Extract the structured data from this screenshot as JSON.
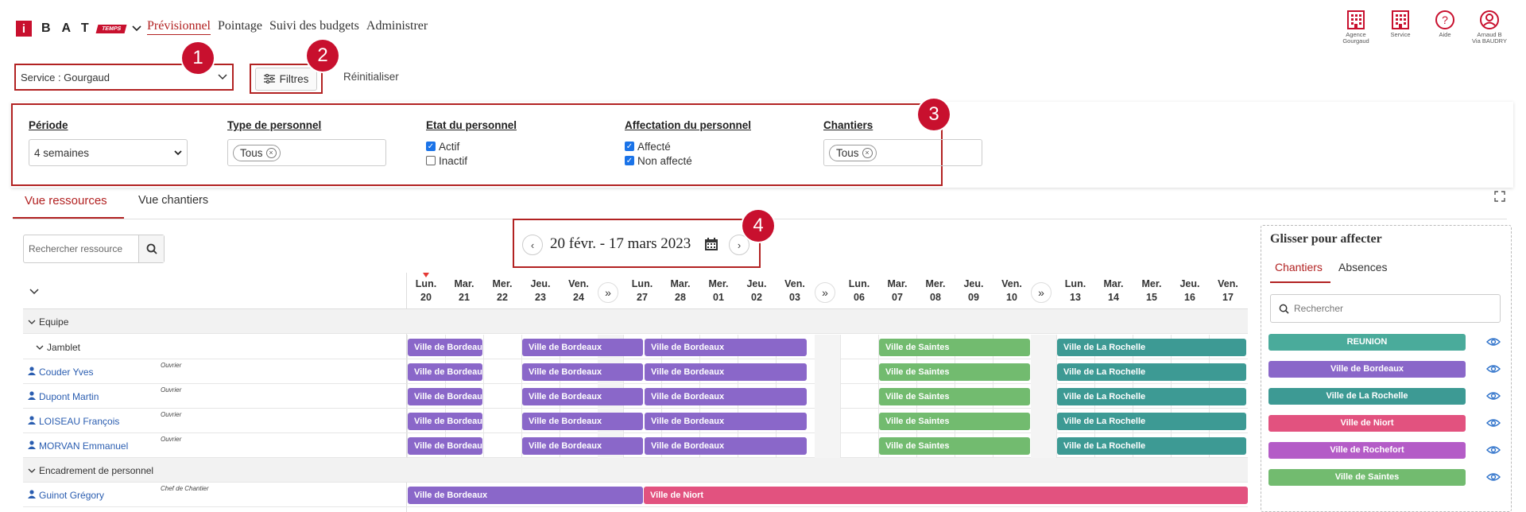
{
  "header": {
    "logo_i": "i",
    "logo_letters": "BAT",
    "logo_temps": "TEMPS",
    "nav": [
      "Prévisionnel",
      "Pointage",
      "Suivi des budgets",
      "Administrer"
    ],
    "icons": [
      {
        "label1": "Agence",
        "label2": "Gourgaud",
        "icon": "building-icon"
      },
      {
        "label1": "Service",
        "label2": "",
        "icon": "building-icon"
      },
      {
        "label1": "Aide",
        "label2": "",
        "icon": "help-icon"
      },
      {
        "label1": "Arnaud B",
        "label2": "Via BAUDRY",
        "icon": "user-icon"
      }
    ]
  },
  "filters": {
    "service": "Service : Gourgaud",
    "filtres_label": "Filtres",
    "reset_label": "Réinitialiser",
    "periode_label": "Période",
    "periode_value": "4 semaines",
    "type_label": "Type de personnel",
    "type_chip": "Tous",
    "etat_label": "Etat du personnel",
    "etat_actif": "Actif",
    "etat_inactif": "Inactif",
    "affect_label": "Affectation du personnel",
    "affect_affecte": "Affecté",
    "affect_non": "Non affecté",
    "chantiers_label": "Chantiers",
    "chantiers_chip": "Tous"
  },
  "badges": [
    "1",
    "2",
    "3",
    "4"
  ],
  "tabs": {
    "ressources": "Vue ressources",
    "chantiers": "Vue chantiers"
  },
  "search_res_placeholder": "Rechercher ressource",
  "date_range": "20 févr. - 17 mars 2023",
  "days": [
    {
      "d": "Lun.",
      "n": "20"
    },
    {
      "d": "Mar.",
      "n": "21"
    },
    {
      "d": "Mer.",
      "n": "22"
    },
    {
      "d": "Jeu.",
      "n": "23"
    },
    {
      "d": "Ven.",
      "n": "24"
    },
    {
      "d": "Lun.",
      "n": "27"
    },
    {
      "d": "Mar.",
      "n": "28"
    },
    {
      "d": "Mer.",
      "n": "01"
    },
    {
      "d": "Jeu.",
      "n": "02"
    },
    {
      "d": "Ven.",
      "n": "03"
    },
    {
      "d": "Lun.",
      "n": "06"
    },
    {
      "d": "Mar.",
      "n": "07"
    },
    {
      "d": "Mer.",
      "n": "08"
    },
    {
      "d": "Jeu.",
      "n": "09"
    },
    {
      "d": "Ven.",
      "n": "10"
    },
    {
      "d": "Lun.",
      "n": "13"
    },
    {
      "d": "Mar.",
      "n": "14"
    },
    {
      "d": "Mer.",
      "n": "15"
    },
    {
      "d": "Jeu.",
      "n": "16"
    },
    {
      "d": "Ven.",
      "n": "17"
    }
  ],
  "rows": [
    {
      "type": "group",
      "name": "Equipe"
    },
    {
      "type": "subgroup",
      "name": "Jamblet"
    },
    {
      "type": "person",
      "name": "Couder Yves",
      "role": "Ouvrier"
    },
    {
      "type": "person",
      "name": "Dupont Martin",
      "role": "Ouvrier"
    },
    {
      "type": "person",
      "name": "LOISEAU François",
      "role": "Ouvrier"
    },
    {
      "type": "person",
      "name": "MORVAN Emmanuel",
      "role": "Ouvrier"
    },
    {
      "type": "group",
      "name": "Encadrement de personnel"
    },
    {
      "type": "person",
      "name": "Guinot Grégory",
      "role": "Chef de Chantier"
    }
  ],
  "assignments": {
    "bordeaux": "Ville de Bordeaux",
    "saintes": "Ville de Saintes",
    "rochelle": "Ville de La Rochelle",
    "niort": "Ville de Niort"
  },
  "right_panel": {
    "title": "Glisser pour affecter",
    "tab_chantiers": "Chantiers",
    "tab_absences": "Absences",
    "search_placeholder": "Rechercher",
    "chantiers": [
      {
        "name": "REUNION",
        "color": "#4aab9b"
      },
      {
        "name": "Ville de Bordeaux",
        "color": "#8a67c9"
      },
      {
        "name": "Ville de La Rochelle",
        "color": "#3d9a94"
      },
      {
        "name": "Ville de Niort",
        "color": "#e2527f"
      },
      {
        "name": "Ville de Rochefort",
        "color": "#b45cc7"
      },
      {
        "name": "Ville de Saintes",
        "color": "#72bb6f"
      }
    ]
  },
  "colors": {
    "accent": "#b22222",
    "bordeaux": "#8a67c9",
    "saintes": "#72bb6f",
    "rochelle": "#3d9a94",
    "niort": "#e2527f"
  }
}
